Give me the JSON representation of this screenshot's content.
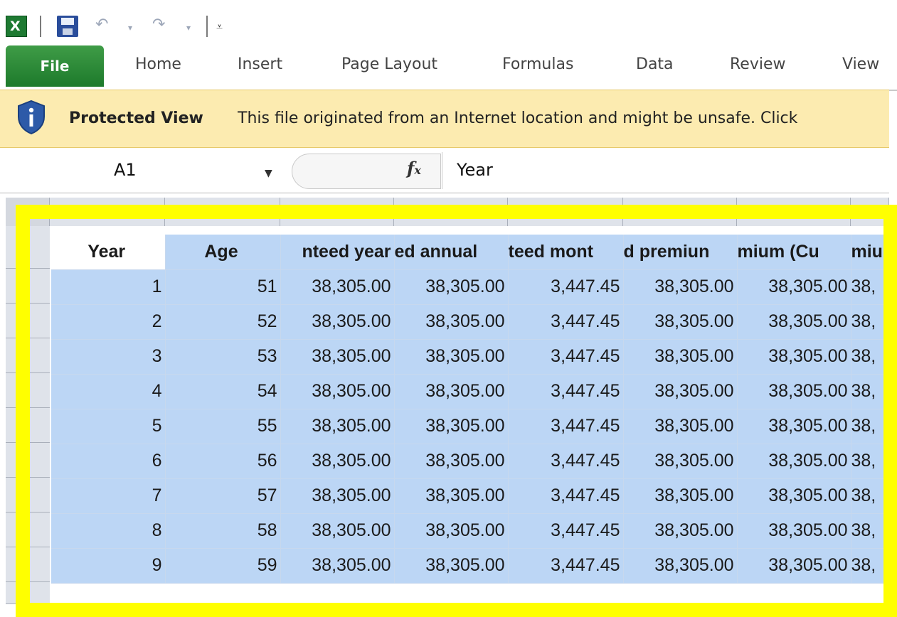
{
  "quick_access": {
    "app_icon": "excel-icon",
    "save_icon": "save-icon",
    "undo_icon": "undo-icon",
    "redo_icon": "redo-icon",
    "customize_icon": "customize-qat-icon"
  },
  "ribbon": {
    "tabs": [
      "File",
      "Home",
      "Insert",
      "Page Layout",
      "Formulas",
      "Data",
      "Review",
      "View"
    ],
    "file_color": "#2a8a36"
  },
  "protected_view": {
    "title": "Protected View",
    "message": "This file originated from an Internet location and might be unsafe. Click",
    "icon": "info-shield-icon",
    "bar_color": "#fcebb0"
  },
  "formula_bar": {
    "name_box": "A1",
    "fx_label": "fx",
    "formula": "Year"
  },
  "sheet": {
    "headers": [
      "Year",
      "Age",
      "nteed year",
      "ed annual",
      "teed mont",
      "d premiun",
      "mium (Cu",
      "miu"
    ],
    "rows": [
      [
        "1",
        "51",
        "38,305.00",
        "38,305.00",
        "3,447.45",
        "38,305.00",
        "38,305.00",
        "38,"
      ],
      [
        "2",
        "52",
        "38,305.00",
        "38,305.00",
        "3,447.45",
        "38,305.00",
        "38,305.00",
        "38,"
      ],
      [
        "3",
        "53",
        "38,305.00",
        "38,305.00",
        "3,447.45",
        "38,305.00",
        "38,305.00",
        "38,"
      ],
      [
        "4",
        "54",
        "38,305.00",
        "38,305.00",
        "3,447.45",
        "38,305.00",
        "38,305.00",
        "38,"
      ],
      [
        "5",
        "55",
        "38,305.00",
        "38,305.00",
        "3,447.45",
        "38,305.00",
        "38,305.00",
        "38,"
      ],
      [
        "6",
        "56",
        "38,305.00",
        "38,305.00",
        "3,447.45",
        "38,305.00",
        "38,305.00",
        "38,"
      ],
      [
        "7",
        "57",
        "38,305.00",
        "38,305.00",
        "3,447.45",
        "38,305.00",
        "38,305.00",
        "38,"
      ],
      [
        "8",
        "58",
        "38,305.00",
        "38,305.00",
        "3,447.45",
        "38,305.00",
        "38,305.00",
        "38,"
      ],
      [
        "9",
        "59",
        "38,305.00",
        "38,305.00",
        "3,447.45",
        "38,305.00",
        "38,305.00",
        "38,"
      ]
    ],
    "partial_row_number": ")",
    "selection_color": "#bcd6f5",
    "highlight_color": "#ffff00"
  }
}
